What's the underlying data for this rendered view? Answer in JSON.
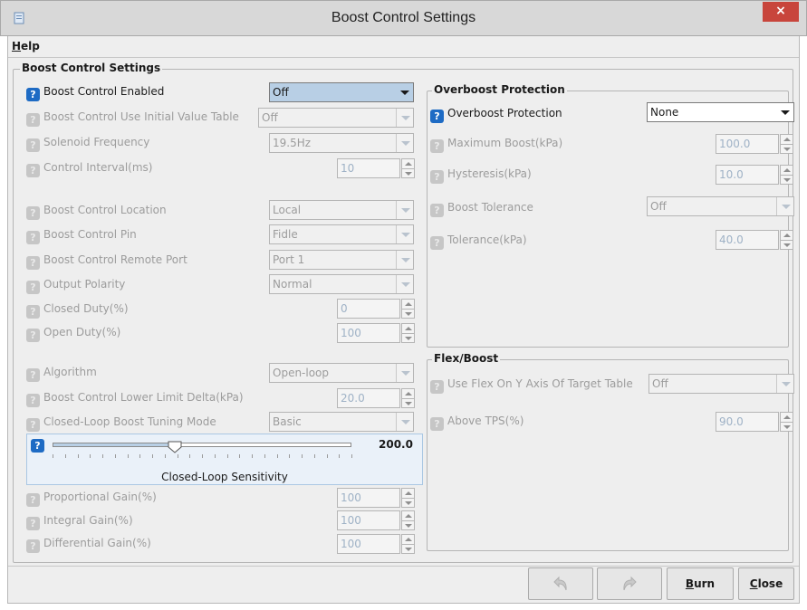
{
  "window": {
    "title": "Boost Control Settings",
    "close_glyph": "×",
    "app_icon": "app-document-icon"
  },
  "menubar": {
    "help_prefix": "H",
    "help_rest": "elp"
  },
  "main_group": {
    "title": "Boost Control Settings",
    "rows": [
      {
        "label": "Boost Control Enabled",
        "value": "Off",
        "enabled": true
      },
      {
        "label": "Boost Control Use Initial Value Table",
        "value": "Off"
      },
      {
        "label": "Solenoid Frequency",
        "value": "19.5Hz"
      },
      {
        "label": "Control Interval(ms)",
        "value": "10"
      },
      {
        "label": "Boost Control Location",
        "value": "Local"
      },
      {
        "label": "Boost Control Pin",
        "value": "Fidle"
      },
      {
        "label": "Boost Control Remote Port",
        "value": "Port 1"
      },
      {
        "label": "Output Polarity",
        "value": "Normal"
      },
      {
        "label": "Closed Duty(%)",
        "value": "0"
      },
      {
        "label": "Open Duty(%)",
        "value": "100"
      },
      {
        "label": "Algorithm",
        "value": "Open-loop"
      },
      {
        "label": "Boost Control Lower Limit Delta(kPa)",
        "value": "20.0"
      },
      {
        "label": "Closed-Loop Boost Tuning Mode",
        "value": "Basic"
      },
      {
        "label": "Proportional Gain(%)",
        "value": "100"
      },
      {
        "label": "Integral Gain(%)",
        "value": "100"
      },
      {
        "label": "Differential Gain(%)",
        "value": "100"
      }
    ],
    "slider": {
      "caption": "Closed-Loop Sensitivity",
      "value_text": "200.0",
      "fraction": 0.41
    }
  },
  "overboost_group": {
    "title": "Overboost Protection",
    "rows": [
      {
        "label": "Overboost Protection",
        "value": "None",
        "enabled": true
      },
      {
        "label": "Maximum Boost(kPa)",
        "value": "100.0"
      },
      {
        "label": "Hysteresis(kPa)",
        "value": "10.0"
      },
      {
        "label": "Boost Tolerance",
        "value": "Off"
      },
      {
        "label": "Tolerance(kPa)",
        "value": "40.0"
      }
    ]
  },
  "flex_group": {
    "title": "Flex/Boost",
    "rows": [
      {
        "label": "Use Flex On Y Axis Of Target Table",
        "value": "Off"
      },
      {
        "label": "Above TPS(%)",
        "value": "90.0"
      }
    ]
  },
  "footer": {
    "undo_icon": "undo-icon",
    "redo_icon": "redo-icon",
    "burn_prefix": "B",
    "burn_rest": "urn",
    "close_prefix": "C",
    "close_rest": "lose"
  },
  "help_glyph": "?",
  "colors": {
    "accent": "#1e6bc4",
    "close": "#c8453c",
    "selected": "#b8cfe5"
  }
}
